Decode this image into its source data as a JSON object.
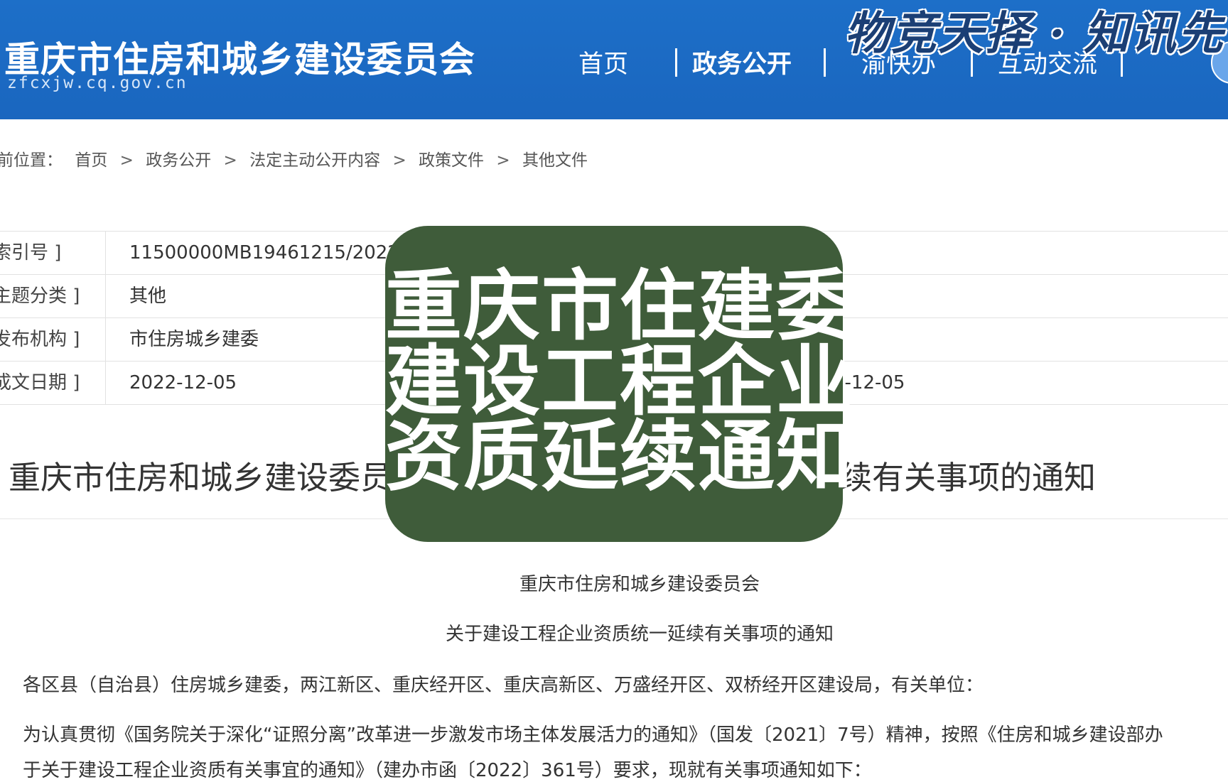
{
  "header": {
    "title": "重庆市住房和城乡建设委员会",
    "domain": "zfcxjw.cq.gov.cn",
    "watermark": "物竞天择 · 知讯先",
    "nav": [
      {
        "label": "首页",
        "active": false
      },
      {
        "label": "政务公开",
        "active": true
      },
      {
        "label": "渝快办",
        "active": false
      },
      {
        "label": "互动交流",
        "active": false
      }
    ]
  },
  "breadcrumb": {
    "prefix": "前位置：",
    "items": [
      "首页",
      "政务公开",
      "法定主动公开内容",
      "政策文件",
      "其他文件"
    ],
    "separator": ">"
  },
  "info": [
    {
      "label": "索引号 ]",
      "value": "11500000MB19461215/2022",
      "value2": ""
    },
    {
      "label": "主题分类 ]",
      "value": "其他",
      "value2": ""
    },
    {
      "label": "发布机构 ]",
      "value": "市住房城乡建委",
      "value2": ""
    },
    {
      "label": "成文日期 ]",
      "value": "2022-12-05",
      "value2": "2-12-05"
    }
  ],
  "article": {
    "title": "重庆市住房和城乡建设委员会关于建设工程企业资质统一延续有关事项的通知",
    "issuer": "重庆市住房和城乡建设委员会",
    "subject": "关于建设工程企业资质统一延续有关事项的通知",
    "para1": "各区县（自治县）住房城乡建委，两江新区、重庆经开区、重庆高新区、万盛经开区、双桥经开区建设局，有关单位：",
    "para2": "为认真贯彻《国务院关于深化“证照分离”改革进一步激发市场主体发展活力的通知》（国发〔2021〕7号）精神，按照《住房和城乡建设部办",
    "para3": "于关于建设工程企业资质有关事宜的通知》（建办市函〔2022〕361号）要求，现就有关事项通知如下："
  },
  "overlay": {
    "lines": [
      "重庆市住建委",
      "建设工程企业",
      "资质延续通知"
    ],
    "color": "#3f5c3a"
  }
}
